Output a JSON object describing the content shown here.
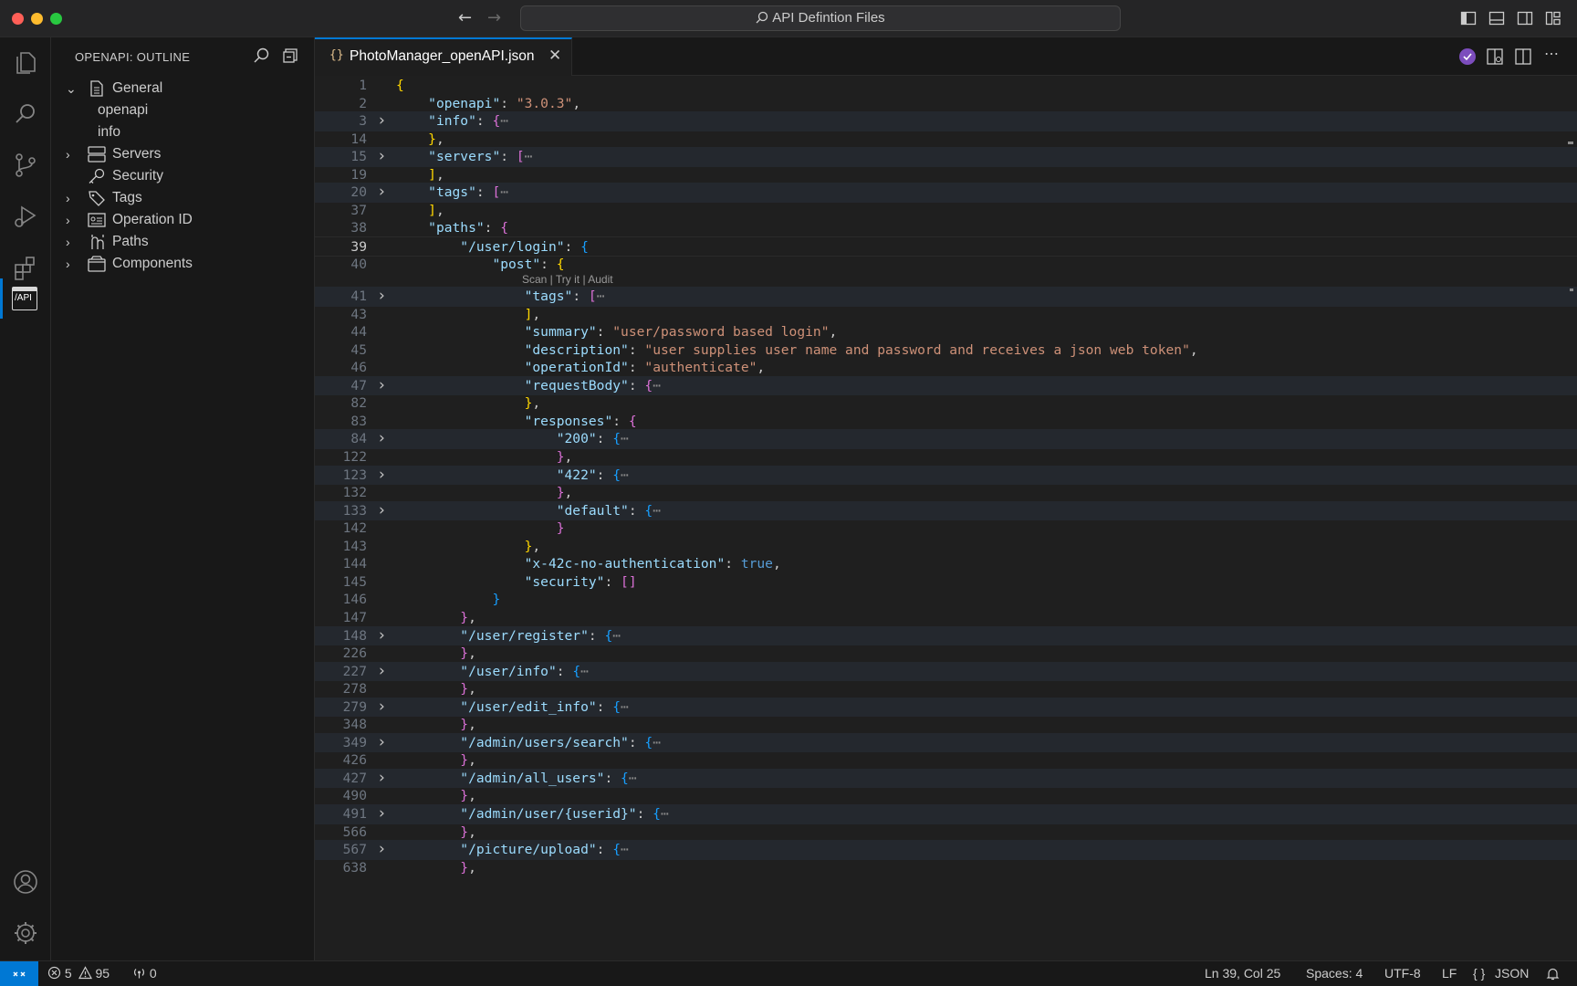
{
  "window": {
    "command_center": "API Defintion Files",
    "colors": {
      "close": "#ff5f57",
      "minimize": "#febc2e",
      "maximize": "#28c840",
      "accent": "#0078d4"
    }
  },
  "activity_bar": {
    "items": [
      "files-icon",
      "search-icon",
      "source-control-icon",
      "run-debug-icon",
      "extensions-icon",
      "api-icon"
    ],
    "bottom": [
      "account-icon",
      "settings-gear-icon"
    ],
    "api_label": "/API"
  },
  "sidebar": {
    "title": "OPENAPI: OUTLINE",
    "items": [
      {
        "label": "General",
        "expanded": true,
        "icon": "document-icon"
      },
      {
        "label": "openapi",
        "child": true
      },
      {
        "label": "info",
        "child": true
      },
      {
        "label": "Servers",
        "icon": "server-icon"
      },
      {
        "label": "Security",
        "icon": "key-icon"
      },
      {
        "label": "Tags",
        "icon": "tag-icon"
      },
      {
        "label": "Operation ID",
        "icon": "id-card-icon"
      },
      {
        "label": "Paths",
        "icon": "paths-icon"
      },
      {
        "label": "Components",
        "icon": "box-icon"
      }
    ]
  },
  "tab": {
    "icon": "{}",
    "label": "PhotoManager_openAPI.json"
  },
  "editor": {
    "code_lens": "Scan | Try it | Audit",
    "lines": [
      {
        "n": "1",
        "code": "{"
      },
      {
        "n": "2",
        "code": "    \"openapi\": \"3.0.3\","
      },
      {
        "n": "3",
        "code": "    \"info\": {⋯",
        "fold": true
      },
      {
        "n": "14",
        "code": "    },"
      },
      {
        "n": "15",
        "code": "    \"servers\": [⋯",
        "fold": true
      },
      {
        "n": "19",
        "code": "    ],"
      },
      {
        "n": "20",
        "code": "    \"tags\": [⋯",
        "fold": true
      },
      {
        "n": "37",
        "code": "    ],"
      },
      {
        "n": "38",
        "code": "    \"paths\": {"
      },
      {
        "n": "39",
        "code": "        \"/user/login\": {",
        "current": true
      },
      {
        "n": "40",
        "code": "            \"post\": {"
      },
      {
        "n": "41",
        "code": "                \"tags\": [⋯",
        "fold": true
      },
      {
        "n": "43",
        "code": "                ],"
      },
      {
        "n": "44",
        "code": "                \"summary\": \"user/password based login\","
      },
      {
        "n": "45",
        "code": "                \"description\": \"user supplies user name and password and receives a json web token\","
      },
      {
        "n": "46",
        "code": "                \"operationId\": \"authenticate\","
      },
      {
        "n": "47",
        "code": "                \"requestBody\": {⋯",
        "fold": true
      },
      {
        "n": "82",
        "code": "                },"
      },
      {
        "n": "83",
        "code": "                \"responses\": {"
      },
      {
        "n": "84",
        "code": "                    \"200\": {⋯",
        "fold": true
      },
      {
        "n": "122",
        "code": "                    },"
      },
      {
        "n": "123",
        "code": "                    \"422\": {⋯",
        "fold": true
      },
      {
        "n": "132",
        "code": "                    },"
      },
      {
        "n": "133",
        "code": "                    \"default\": {⋯",
        "fold": true
      },
      {
        "n": "142",
        "code": "                    }"
      },
      {
        "n": "143",
        "code": "                },"
      },
      {
        "n": "144",
        "code": "                \"x-42c-no-authentication\": true,"
      },
      {
        "n": "145",
        "code": "                \"security\": []"
      },
      {
        "n": "146",
        "code": "            }"
      },
      {
        "n": "147",
        "code": "        },"
      },
      {
        "n": "148",
        "code": "        \"/user/register\": {⋯",
        "fold": true
      },
      {
        "n": "226",
        "code": "        },"
      },
      {
        "n": "227",
        "code": "        \"/user/info\": {⋯",
        "fold": true
      },
      {
        "n": "278",
        "code": "        },"
      },
      {
        "n": "279",
        "code": "        \"/user/edit_info\": {⋯",
        "fold": true
      },
      {
        "n": "348",
        "code": "        },"
      },
      {
        "n": "349",
        "code": "        \"/admin/users/search\": {⋯",
        "fold": true
      },
      {
        "n": "426",
        "code": "        },"
      },
      {
        "n": "427",
        "code": "        \"/admin/all_users\": {⋯",
        "fold": true
      },
      {
        "n": "490",
        "code": "        },"
      },
      {
        "n": "491",
        "code": "        \"/admin/user/{userid}\": {⋯",
        "fold": true
      },
      {
        "n": "566",
        "code": "        },"
      },
      {
        "n": "567",
        "code": "        \"/picture/upload\": {⋯",
        "fold": true
      },
      {
        "n": "638",
        "code": "        },"
      }
    ]
  },
  "status": {
    "errors": "5",
    "warnings": "95",
    "ports": "0",
    "position": "Ln 39, Col 25",
    "spaces": "Spaces: 4",
    "encoding": "UTF-8",
    "eol": "LF",
    "language": "JSON",
    "language_icon": "{ }"
  }
}
